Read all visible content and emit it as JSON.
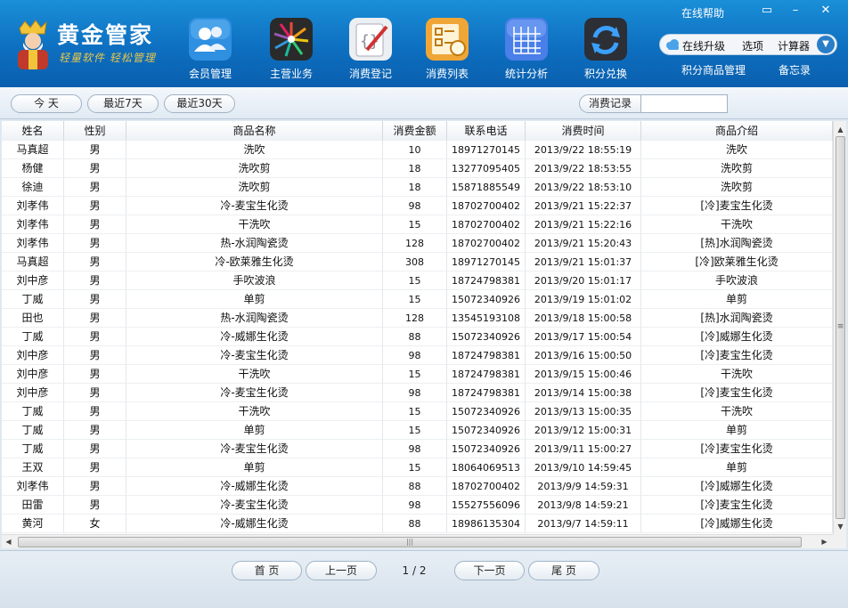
{
  "app": {
    "name": "黄金管家",
    "slogan": "轻量软件 轻松管理"
  },
  "nav": [
    {
      "label": "会员管理",
      "icon": "members-icon"
    },
    {
      "label": "主营业务",
      "icon": "business-icon"
    },
    {
      "label": "消费登记",
      "icon": "register-icon"
    },
    {
      "label": "消费列表",
      "icon": "list-icon"
    },
    {
      "label": "统计分析",
      "icon": "statistics-icon"
    },
    {
      "label": "积分兑换",
      "icon": "points-exchange-icon"
    }
  ],
  "window": {
    "help": "在线帮助",
    "minimize": "–",
    "close": "✕",
    "restore": "▭"
  },
  "topbar": {
    "upgrade": "在线升级",
    "options": "选项",
    "calculator": "计算器",
    "points_goods": "积分商品管理",
    "memo": "备忘录"
  },
  "filters": {
    "today": "今 天",
    "last7": "最近7天",
    "last30": "最近30天",
    "search_label": "消费记录",
    "search_value": ""
  },
  "table": {
    "columns": [
      "姓名",
      "性别",
      "商品名称",
      "消费金额",
      "联系电话",
      "消费时间",
      "商品介绍"
    ],
    "rows": [
      [
        "马真超",
        "男",
        "洗吹",
        "10",
        "18971270145",
        "2013/9/22  18:55:19",
        "洗吹"
      ],
      [
        "杨健",
        "男",
        "洗吹剪",
        "18",
        "13277095405",
        "2013/9/22  18:53:55",
        "洗吹剪"
      ],
      [
        "徐迪",
        "男",
        "洗吹剪",
        "18",
        "15871885549",
        "2013/9/22  18:53:10",
        "洗吹剪"
      ],
      [
        "刘孝伟",
        "男",
        "冷-麦宝生化烫",
        "98",
        "18702700402",
        "2013/9/21  15:22:37",
        "[冷]麦宝生化烫"
      ],
      [
        "刘孝伟",
        "男",
        "干洗吹",
        "15",
        "18702700402",
        "2013/9/21  15:22:16",
        "干洗吹"
      ],
      [
        "刘孝伟",
        "男",
        "热-水润陶瓷烫",
        "128",
        "18702700402",
        "2013/9/21  15:20:43",
        "[热]水润陶瓷烫"
      ],
      [
        "马真超",
        "男",
        "冷-欧莱雅生化烫",
        "308",
        "18971270145",
        "2013/9/21  15:01:37",
        "[冷]欧莱雅生化烫"
      ],
      [
        "刘中彦",
        "男",
        "手吹波浪",
        "15",
        "18724798381",
        "2013/9/20  15:01:17",
        "手吹波浪"
      ],
      [
        "丁威",
        "男",
        "单剪",
        "15",
        "15072340926",
        "2013/9/19  15:01:02",
        "单剪"
      ],
      [
        "田也",
        "男",
        "热-水润陶瓷烫",
        "128",
        "13545193108",
        "2013/9/18  15:00:58",
        "[热]水润陶瓷烫"
      ],
      [
        "丁威",
        "男",
        "冷-威娜生化烫",
        "88",
        "15072340926",
        "2013/9/17  15:00:54",
        "[冷]威娜生化烫"
      ],
      [
        "刘中彦",
        "男",
        "冷-麦宝生化烫",
        "98",
        "18724798381",
        "2013/9/16  15:00:50",
        "[冷]麦宝生化烫"
      ],
      [
        "刘中彦",
        "男",
        "干洗吹",
        "15",
        "18724798381",
        "2013/9/15  15:00:46",
        "干洗吹"
      ],
      [
        "刘中彦",
        "男",
        "冷-麦宝生化烫",
        "98",
        "18724798381",
        "2013/9/14  15:00:38",
        "[冷]麦宝生化烫"
      ],
      [
        "丁威",
        "男",
        "干洗吹",
        "15",
        "15072340926",
        "2013/9/13  15:00:35",
        "干洗吹"
      ],
      [
        "丁威",
        "男",
        "单剪",
        "15",
        "15072340926",
        "2013/9/12  15:00:31",
        "单剪"
      ],
      [
        "丁威",
        "男",
        "冷-麦宝生化烫",
        "98",
        "15072340926",
        "2013/9/11  15:00:27",
        "[冷]麦宝生化烫"
      ],
      [
        "王双",
        "男",
        "单剪",
        "15",
        "18064069513",
        "2013/9/10  14:59:45",
        "单剪"
      ],
      [
        "刘孝伟",
        "男",
        "冷-威娜生化烫",
        "88",
        "18702700402",
        "2013/9/9  14:59:31",
        "[冷]威娜生化烫"
      ],
      [
        "田雷",
        "男",
        "冷-麦宝生化烫",
        "98",
        "15527556096",
        "2013/9/8  14:59:21",
        "[冷]麦宝生化烫"
      ],
      [
        "黄河",
        "女",
        "冷-威娜生化烫",
        "88",
        "18986135304",
        "2013/9/7  14:59:11",
        "[冷]威娜生化烫"
      ]
    ]
  },
  "scroll": {
    "up": "▲",
    "down": "▼",
    "left": "◀",
    "right": "▶",
    "grip_v": "≡",
    "grip_h": "|||"
  },
  "pager": {
    "first": "首 页",
    "prev": "上一页",
    "info": "1 / 2",
    "next": "下一页",
    "last": "尾 页"
  }
}
